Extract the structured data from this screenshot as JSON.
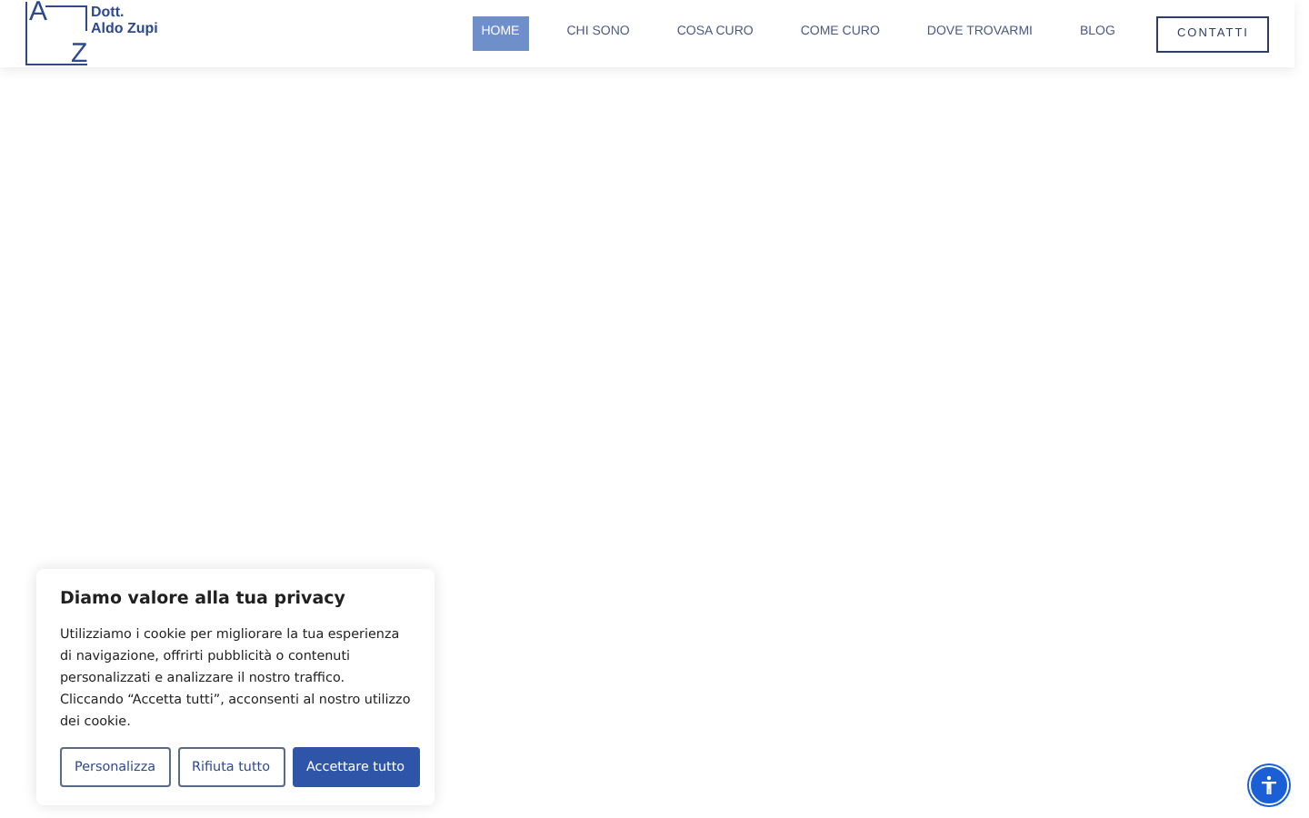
{
  "logo": {
    "letters": [
      "A",
      "Z"
    ],
    "lines": [
      "Dott.",
      "Aldo Zupi"
    ]
  },
  "nav": [
    {
      "label": "HOME",
      "selected": true
    },
    {
      "label": "CHI SONO",
      "selected": false
    },
    {
      "label": "COSA CURO",
      "selected": false
    },
    {
      "label": "COME CURO",
      "selected": false
    },
    {
      "label": "DOVE TROVARMI",
      "selected": false
    },
    {
      "label": "BLOG",
      "selected": false
    }
  ],
  "cta": "CONTATTI",
  "cookie_banner": {
    "title": "Diamo valore alla tua privacy",
    "text": "Utilizziamo i cookie per migliorare la tua esperienza di navigazione, offrirti pubblicità o contenuti personalizzati e analizzare il nostro traffico. Cliccando “Accetta tutti”, acconsenti al nostro utilizzo dei cookie.",
    "buttons": [
      {
        "label": "Personalizza",
        "kind": "outline"
      },
      {
        "label": "Rifiuta tutto",
        "kind": "outline"
      },
      {
        "label": "Accettare tutto",
        "kind": "primary"
      }
    ]
  }
}
